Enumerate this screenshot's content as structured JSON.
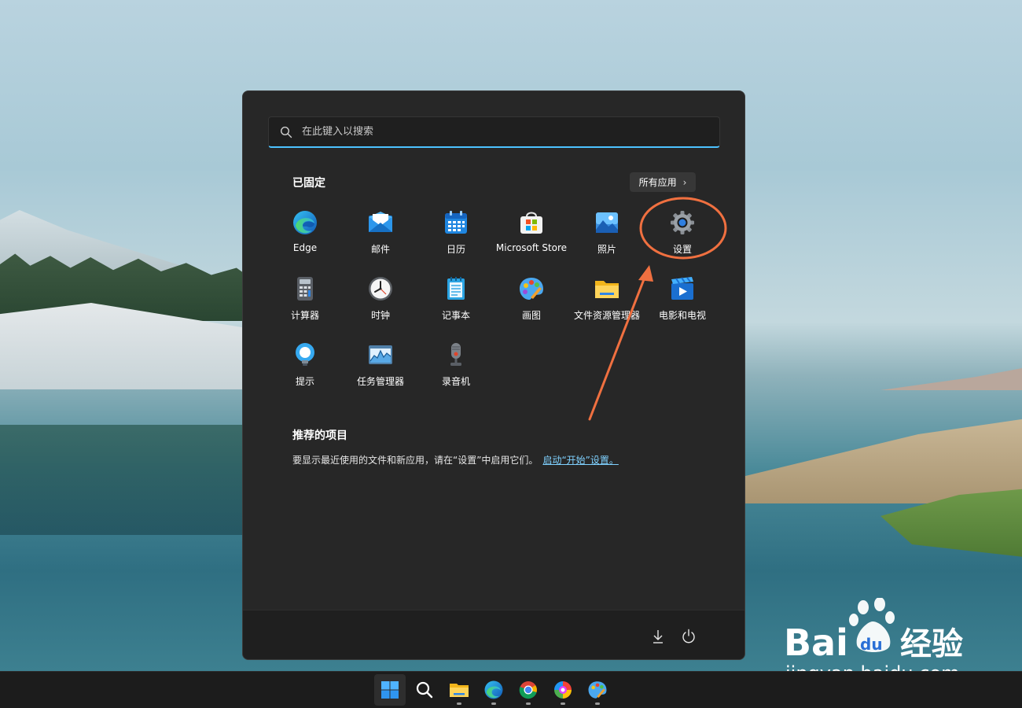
{
  "search": {
    "placeholder": "在此键入以搜索"
  },
  "pinned": {
    "title": "已固定",
    "all_apps_label": "所有应用",
    "apps": [
      {
        "label": "Edge",
        "icon": "edge-icon"
      },
      {
        "label": "邮件",
        "icon": "mail-icon"
      },
      {
        "label": "日历",
        "icon": "calendar-icon"
      },
      {
        "label": "Microsoft Store",
        "icon": "store-icon"
      },
      {
        "label": "照片",
        "icon": "photos-icon"
      },
      {
        "label": "设置",
        "icon": "settings-gear-icon"
      },
      {
        "label": "计算器",
        "icon": "calculator-icon"
      },
      {
        "label": "时钟",
        "icon": "clock-icon"
      },
      {
        "label": "记事本",
        "icon": "notepad-icon"
      },
      {
        "label": "画图",
        "icon": "paint-icon"
      },
      {
        "label": "文件资源管理器",
        "icon": "folder-icon"
      },
      {
        "label": "电影和电视",
        "icon": "movies-tv-icon"
      },
      {
        "label": "提示",
        "icon": "tips-bulb-icon"
      },
      {
        "label": "任务管理器",
        "icon": "task-manager-icon"
      },
      {
        "label": "录音机",
        "icon": "voice-recorder-icon"
      }
    ]
  },
  "recommended": {
    "title": "推荐的项目",
    "text": "要显示最近使用的文件和新应用，请在“设置”中启用它们。",
    "link": "启动“开始”设置。"
  },
  "footer": {
    "icons": [
      "download-icon",
      "power-icon"
    ]
  },
  "watermark": {
    "brand": "Bai du 经验",
    "url": "jingyan.baidu.com"
  },
  "taskbar": {
    "icons": [
      "windows-start-icon",
      "search-icon",
      "file-explorer-icon",
      "edge-icon",
      "chrome-icon",
      "colorful-app-icon",
      "paint-icon"
    ]
  },
  "colors": {
    "accent": "#4cc2ff",
    "annotation": "#f07040",
    "menu_bg": "#272727"
  }
}
